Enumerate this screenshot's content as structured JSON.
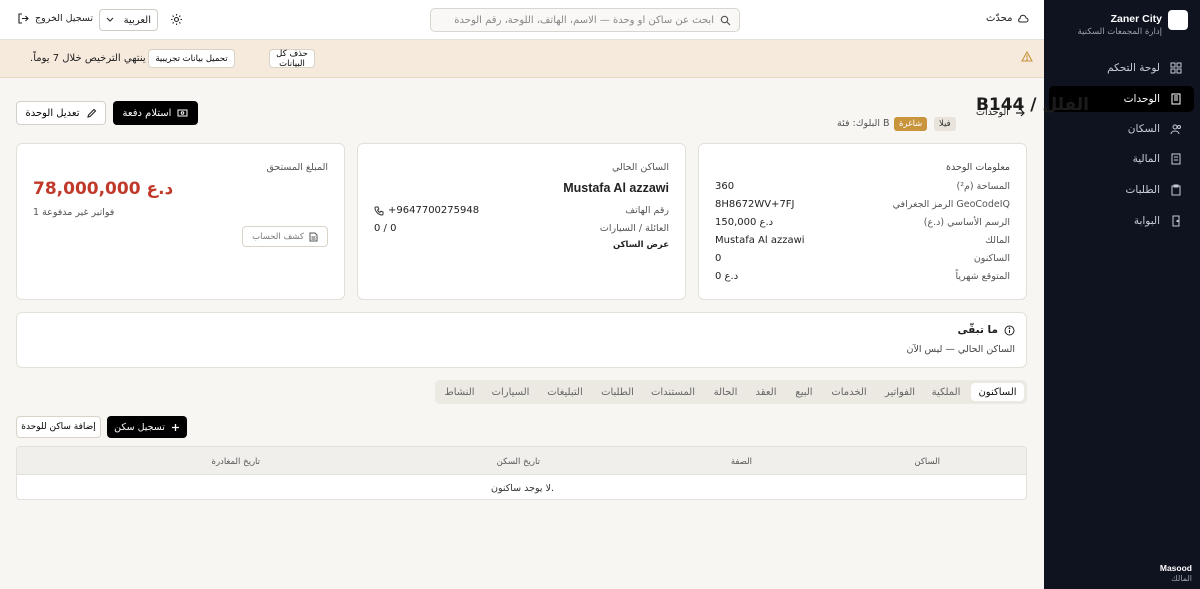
{
  "brand": {
    "name": "Zaner City",
    "subtitle": "إدارة المجمعات السكنية"
  },
  "nav": [
    {
      "label": "لوحة التحكم",
      "icon": "grid-icon"
    },
    {
      "label": "الوحدات",
      "icon": "building-icon",
      "active": true
    },
    {
      "label": "السكان",
      "icon": "users-icon"
    },
    {
      "label": "المالية",
      "icon": "receipt-icon"
    },
    {
      "label": "الطلبات",
      "icon": "clipboard-icon"
    },
    {
      "label": "البوابة",
      "icon": "door-icon"
    }
  ],
  "user": {
    "name": "Masood",
    "role": "المالك"
  },
  "topbar": {
    "sync_label": "محدّث",
    "search_placeholder": "ابحث عن ساكن أو وحدة — الاسم، الهاتف، اللوحة، رقم الوحدة",
    "language": "العربية",
    "logout": "تسجيل الخروج"
  },
  "banner": {
    "text": ".ينتهي الترخيص خلال 7 يوماً",
    "load_demo": "تحميل بيانات تجريبية",
    "delete_all": "حذف كل البيانات"
  },
  "header": {
    "back": "الوحدات",
    "title": "B144 / الفلل",
    "type_badge": "فيلا",
    "status_badge": "شاغرة",
    "block": "البلوك: فئة B",
    "receive_payment": "استلام دفعة",
    "edit_unit": "تعديل الوحدة"
  },
  "unit_info": {
    "heading": "معلومات الوحدة",
    "rows": [
      {
        "label": "المساحة (م²)",
        "value": "360"
      },
      {
        "label": "الرمز الجغرافي GeoCodeIQ",
        "value": "8H8672WV+7FJ"
      },
      {
        "label": "الرسم الأساسي (د.ع)",
        "value": "150,000 د.ع"
      },
      {
        "label": "المالك",
        "value": "Mustafa Al azzawi"
      },
      {
        "label": "الساكنون",
        "value": "0"
      },
      {
        "label": "المتوقع شهرياً",
        "value": "0 د.ع"
      }
    ]
  },
  "resident": {
    "heading": "الساكن الحالي",
    "name": "Mustafa Al azzawi",
    "phone_label": "رقم الهاتف",
    "phone": "+9647700275948",
    "family_label": "العائلة / السيارات",
    "family": "0 / 0",
    "view_link": "عرض الساكن"
  },
  "due": {
    "heading": "المبلغ المستحق",
    "amount": "78,000,000 د.ع",
    "unpaid": "1 فواتير غير مدفوعة",
    "statement": "كشف الحساب"
  },
  "remaining": {
    "heading": "ما تبقّى",
    "text": "الساكن الحالي — ليس الآن"
  },
  "tabs": [
    "الساكنون",
    "الملكية",
    "الفواتير",
    "الخدمات",
    "البيع",
    "العقد",
    "الحالة",
    "المستندات",
    "الطلبات",
    "التبليغات",
    "السيارات",
    "النشاط"
  ],
  "residents_table": {
    "register": "تسجيل سكن",
    "add_resident": "إضافة ساكن للوحدة",
    "columns": [
      "الساكن",
      "الصفة",
      "تاريخ السكن",
      "تاريخ المغادرة"
    ],
    "empty": "لا يوجد ساكنون."
  },
  "colors": {
    "sidebar": "#0f1320",
    "accent": "#c8943c",
    "due": "#c0392b",
    "banner": "#f6eadd"
  }
}
